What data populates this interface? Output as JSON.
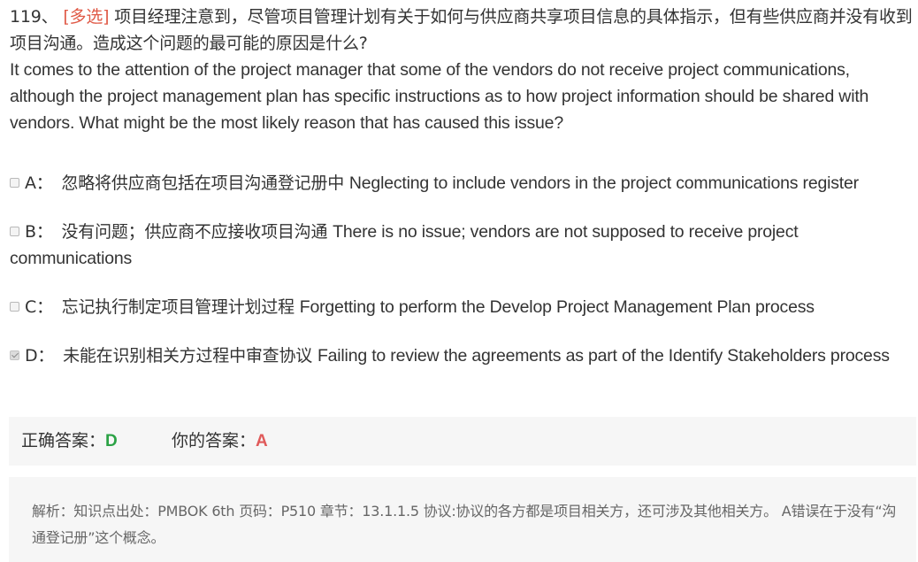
{
  "question": {
    "number": "119、",
    "type_tag": "[多选]",
    "text_cn": "项目经理注意到，尽管项目管理计划有关于如何与供应商共享项目信息的具体指示，但有些供应商并没有收到项目沟通。造成这个问题的最可能的原因是什么?",
    "text_en": "It comes to the attention of the project manager that some of the vendors do not receive project communications, although the project management plan has specific instructions as to how project information should be shared with vendors. What might be the most likely reason that has caused this issue?"
  },
  "options": [
    {
      "letter": "A：",
      "text_cn": "忽略将供应商包括在项目沟通登记册中",
      "text_en": "Neglecting to include vendors in the project communications register",
      "checked": false
    },
    {
      "letter": "B：",
      "text_cn": "没有问题；供应商不应接收项目沟通",
      "text_en": "There is no issue; vendors are not supposed to receive project communications",
      "checked": false
    },
    {
      "letter": "C：",
      "text_cn": "忘记执行制定项目管理计划过程",
      "text_en": "Forgetting to perform the Develop Project Management Plan process",
      "checked": false
    },
    {
      "letter": "D：",
      "text_cn": "未能在识别相关方过程中审查协议",
      "text_en": "Failing to review the agreements as part of the Identify Stakeholders process",
      "checked": true
    }
  ],
  "answer": {
    "correct_label": "正确答案：",
    "correct_value": "D",
    "your_label": "你的答案：",
    "your_value": "A"
  },
  "explanation": {
    "text": "解析：知识点出处：PMBOK 6th 页码：P510 章节：13.1.1.5 协议:协议的各方都是项目相关方，还可涉及其他相关方。 A错误在于没有“沟通登记册”这个概念。"
  },
  "colors": {
    "type_tag": "#e05a47",
    "correct": "#2ba245",
    "wrong": "#e05a5a",
    "panel_bg": "#f6f6f6"
  }
}
